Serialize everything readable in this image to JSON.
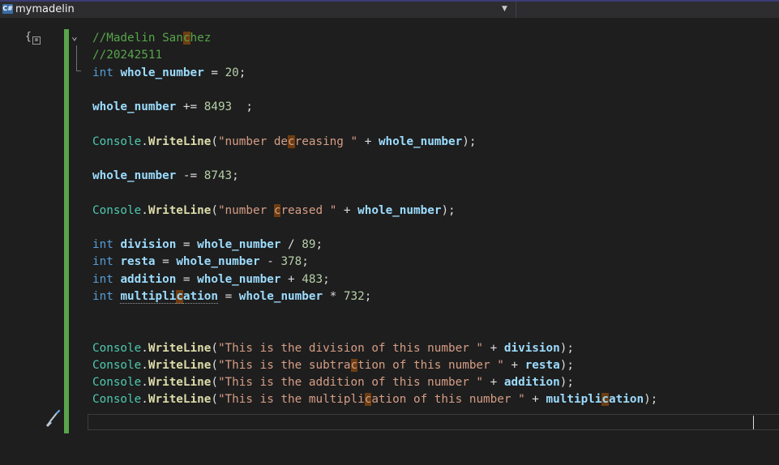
{
  "tab": {
    "icon": "C#",
    "title": "mymadelin",
    "dropdown": "▼"
  },
  "code_lines": [
    [
      {
        "t": "//Madelin San",
        "c": "c"
      },
      {
        "t": "c",
        "c": "c hl"
      },
      {
        "t": "hez",
        "c": "c"
      }
    ],
    [
      {
        "t": "//20242511",
        "c": "c"
      }
    ],
    [
      {
        "t": "int",
        "c": "k"
      },
      {
        "t": " ",
        "c": "op"
      },
      {
        "t": "whole_number",
        "c": "v"
      },
      {
        "t": " = ",
        "c": "op"
      },
      {
        "t": "20",
        "c": "n"
      },
      {
        "t": ";",
        "c": "op"
      }
    ],
    [],
    [
      {
        "t": "whole_number",
        "c": "v"
      },
      {
        "t": " += ",
        "c": "op"
      },
      {
        "t": "8493",
        "c": "n"
      },
      {
        "t": "  ;",
        "c": "op"
      }
    ],
    [],
    [
      {
        "t": "Console",
        "c": "t"
      },
      {
        "t": ".",
        "c": "op"
      },
      {
        "t": "WriteLine",
        "c": "m"
      },
      {
        "t": "(",
        "c": "op"
      },
      {
        "t": "\"number de",
        "c": "s"
      },
      {
        "t": "c",
        "c": "s hl"
      },
      {
        "t": "reasing \"",
        "c": "s"
      },
      {
        "t": " + ",
        "c": "op"
      },
      {
        "t": "whole_number",
        "c": "v"
      },
      {
        "t": ");",
        "c": "op"
      }
    ],
    [],
    [
      {
        "t": "whole_number",
        "c": "v"
      },
      {
        "t": " -= ",
        "c": "op"
      },
      {
        "t": "8743",
        "c": "n"
      },
      {
        "t": ";",
        "c": "op"
      }
    ],
    [],
    [
      {
        "t": "Console",
        "c": "t"
      },
      {
        "t": ".",
        "c": "op"
      },
      {
        "t": "WriteLine",
        "c": "m"
      },
      {
        "t": "(",
        "c": "op"
      },
      {
        "t": "\"number ",
        "c": "s"
      },
      {
        "t": "c",
        "c": "s hl"
      },
      {
        "t": "reased \"",
        "c": "s"
      },
      {
        "t": " + ",
        "c": "op"
      },
      {
        "t": "whole_number",
        "c": "v"
      },
      {
        "t": ");",
        "c": "op"
      }
    ],
    [],
    [
      {
        "t": "int",
        "c": "k"
      },
      {
        "t": " ",
        "c": "op"
      },
      {
        "t": "division",
        "c": "v"
      },
      {
        "t": " = ",
        "c": "op"
      },
      {
        "t": "whole_number",
        "c": "v"
      },
      {
        "t": " / ",
        "c": "op"
      },
      {
        "t": "89",
        "c": "n"
      },
      {
        "t": ";",
        "c": "op"
      }
    ],
    [
      {
        "t": "int",
        "c": "k"
      },
      {
        "t": " ",
        "c": "op"
      },
      {
        "t": "resta",
        "c": "v"
      },
      {
        "t": " = ",
        "c": "op"
      },
      {
        "t": "whole_number",
        "c": "v"
      },
      {
        "t": " - ",
        "c": "op"
      },
      {
        "t": "378",
        "c": "n"
      },
      {
        "t": ";",
        "c": "op"
      }
    ],
    [
      {
        "t": "int",
        "c": "k"
      },
      {
        "t": " ",
        "c": "op"
      },
      {
        "t": "addition",
        "c": "v"
      },
      {
        "t": " = ",
        "c": "op"
      },
      {
        "t": "whole_number",
        "c": "v"
      },
      {
        "t": " + ",
        "c": "op"
      },
      {
        "t": "483",
        "c": "n"
      },
      {
        "t": ";",
        "c": "op"
      }
    ],
    [
      {
        "t": "int",
        "c": "k"
      },
      {
        "t": " ",
        "c": "op"
      },
      {
        "t": "multipli",
        "c": "v dot"
      },
      {
        "t": "c",
        "c": "v dot hl"
      },
      {
        "t": "ation",
        "c": "v dot"
      },
      {
        "t": " = ",
        "c": "op"
      },
      {
        "t": "whole_number",
        "c": "v"
      },
      {
        "t": " * ",
        "c": "op"
      },
      {
        "t": "732",
        "c": "n"
      },
      {
        "t": ";",
        "c": "op"
      }
    ],
    [],
    [],
    [
      {
        "t": "Console",
        "c": "t"
      },
      {
        "t": ".",
        "c": "op"
      },
      {
        "t": "WriteLine",
        "c": "m"
      },
      {
        "t": "(",
        "c": "op"
      },
      {
        "t": "\"This is the division of this number \"",
        "c": "s"
      },
      {
        "t": " + ",
        "c": "op"
      },
      {
        "t": "division",
        "c": "v"
      },
      {
        "t": ");",
        "c": "op"
      }
    ],
    [
      {
        "t": "Console",
        "c": "t"
      },
      {
        "t": ".",
        "c": "op"
      },
      {
        "t": "WriteLine",
        "c": "m"
      },
      {
        "t": "(",
        "c": "op"
      },
      {
        "t": "\"This is the subtra",
        "c": "s"
      },
      {
        "t": "c",
        "c": "s hl"
      },
      {
        "t": "tion of this number \"",
        "c": "s"
      },
      {
        "t": " + ",
        "c": "op"
      },
      {
        "t": "resta",
        "c": "v"
      },
      {
        "t": ");",
        "c": "op"
      }
    ],
    [
      {
        "t": "Console",
        "c": "t"
      },
      {
        "t": ".",
        "c": "op"
      },
      {
        "t": "WriteLine",
        "c": "m"
      },
      {
        "t": "(",
        "c": "op"
      },
      {
        "t": "\"This is the addition of this number \"",
        "c": "s"
      },
      {
        "t": " + ",
        "c": "op"
      },
      {
        "t": "addition",
        "c": "v"
      },
      {
        "t": ");",
        "c": "op"
      }
    ],
    [
      {
        "t": "Console",
        "c": "t"
      },
      {
        "t": ".",
        "c": "op"
      },
      {
        "t": "WriteLine",
        "c": "m"
      },
      {
        "t": "(",
        "c": "op"
      },
      {
        "t": "\"This is the multipli",
        "c": "s"
      },
      {
        "t": "c",
        "c": "s hl"
      },
      {
        "t": "ation of this number \"",
        "c": "s"
      },
      {
        "t": " + ",
        "c": "op"
      },
      {
        "t": "multipli",
        "c": "v"
      },
      {
        "t": "c",
        "c": "v hl"
      },
      {
        "t": "ation",
        "c": "v"
      },
      {
        "t": ");",
        "c": "op"
      }
    ]
  ],
  "icons": {
    "tab_icon": "csharp-file-icon",
    "quick_action": "code-snippet-icon",
    "fold": "collapse-chevron-icon",
    "brush": "code-cleanup-brush-icon"
  },
  "colors": {
    "background": "#1e1e1e",
    "changebar": "#57a64a",
    "keyword": "#569cd6",
    "type": "#4ec9b0",
    "method": "#dcdcaa",
    "string": "#d69d85",
    "number": "#b5cea8",
    "comment": "#57a64a",
    "highlight": "#6f3d11"
  }
}
